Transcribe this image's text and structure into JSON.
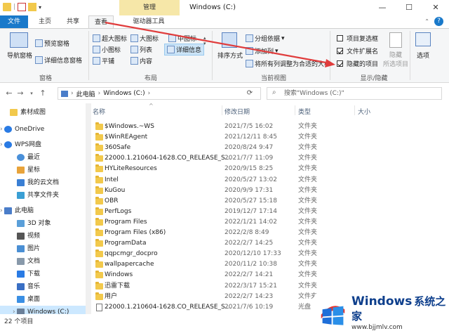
{
  "titlebar": {
    "title": "Windows (C:)",
    "manage_tab": "管理",
    "minimize": "—",
    "maximize": "☐",
    "close": "✕"
  },
  "tabs": [
    "文件",
    "主页",
    "共享",
    "查看",
    "驱动器工具"
  ],
  "ribbon": {
    "nav_pane": "导航窗格",
    "preview_pane": "预览窗格",
    "details_pane": "详细信息窗格",
    "group_pane": "窗格",
    "layouts": [
      "超大图标",
      "大图标",
      "中图标",
      "小图标",
      "列表",
      "详细信息",
      "平铺",
      "内容"
    ],
    "group_layout": "布局",
    "sort_by": "排序方式",
    "group_by": "分组依据",
    "add_column": "添加列",
    "fit_columns": "将所有列调整为合适的大小",
    "group_current_view": "当前视图",
    "item_checkboxes": "项目复选框",
    "file_extensions": "文件扩展名",
    "hidden_items": "隐藏的项目",
    "hide": "隐藏",
    "hide_selected": "所选项目",
    "options": "选项",
    "group_show_hide": "显示/隐藏",
    "checkbox_states": {
      "item_checkboxes": false,
      "file_extensions": true,
      "hidden_items": true
    }
  },
  "address": {
    "path": [
      "此电脑",
      "Windows (C:)"
    ],
    "search_placeholder": "搜索\"Windows (C:)\"",
    "back": "←",
    "forward": "→",
    "up": "↑",
    "refresh": "⟳"
  },
  "nav": [
    {
      "label": "素材成图",
      "icon": "folder-icon"
    },
    {
      "label": "OneDrive",
      "icon": "cloud-icon"
    },
    {
      "label": "WPS网盘",
      "icon": "cloud-icon"
    },
    {
      "label": "最近",
      "icon": "clock-icon"
    },
    {
      "label": "星标",
      "icon": "star-icon"
    },
    {
      "label": "我的云文档",
      "icon": "cloud-doc-icon"
    },
    {
      "label": "共享文件夹",
      "icon": "share-icon"
    },
    {
      "label": "此电脑",
      "icon": "computer-icon"
    },
    {
      "label": "3D 对象",
      "icon": "cube-icon"
    },
    {
      "label": "视频",
      "icon": "video-icon"
    },
    {
      "label": "图片",
      "icon": "picture-icon"
    },
    {
      "label": "文档",
      "icon": "document-icon"
    },
    {
      "label": "下载",
      "icon": "download-icon"
    },
    {
      "label": "音乐",
      "icon": "music-icon"
    },
    {
      "label": "桌面",
      "icon": "desktop-icon"
    },
    {
      "label": "Windows (C:)",
      "icon": "drive-icon"
    }
  ],
  "columns": {
    "name": "名称",
    "date": "修改日期",
    "type": "类型",
    "size": "大小"
  },
  "files": [
    {
      "name": "$Windows.~WS",
      "date": "2021/7/5 16:02",
      "type": "文件夹"
    },
    {
      "name": "$WinREAgent",
      "date": "2021/12/11 8:45",
      "type": "文件夹"
    },
    {
      "name": "360Safe",
      "date": "2020/8/24 9:47",
      "type": "文件夹"
    },
    {
      "name": "22000.1.210604-1628.CO_RELEASE_S...",
      "date": "2021/7/7 11:09",
      "type": "文件夹"
    },
    {
      "name": "HYLiteResources",
      "date": "2020/9/15 8:25",
      "type": "文件夹"
    },
    {
      "name": "Intel",
      "date": "2020/5/27 13:02",
      "type": "文件夹"
    },
    {
      "name": "KuGou",
      "date": "2020/9/9 17:31",
      "type": "文件夹"
    },
    {
      "name": "OBR",
      "date": "2020/5/27 15:18",
      "type": "文件夹"
    },
    {
      "name": "PerfLogs",
      "date": "2019/12/7 17:14",
      "type": "文件夹"
    },
    {
      "name": "Program Files",
      "date": "2022/1/21 14:02",
      "type": "文件夹"
    },
    {
      "name": "Program Files (x86)",
      "date": "2022/2/8 8:49",
      "type": "文件夹"
    },
    {
      "name": "ProgramData",
      "date": "2022/2/7 14:25",
      "type": "文件夹"
    },
    {
      "name": "qqpcmgr_docpro",
      "date": "2020/12/10 17:33",
      "type": "文件夹"
    },
    {
      "name": "wallpapercache",
      "date": "2020/11/2 10:38",
      "type": "文件夹"
    },
    {
      "name": "Windows",
      "date": "2022/2/7 14:21",
      "type": "文件夹"
    },
    {
      "name": "迅雷下载",
      "date": "2022/3/17 15:21",
      "type": "文件夹"
    },
    {
      "name": "用户",
      "date": "2022/2/7 14:23",
      "type": "文件夹"
    },
    {
      "name": "22000.1.210604-1628.CO_RELEASE_S...",
      "date": "2021/7/6 10:19",
      "type": "光盘"
    }
  ],
  "status": {
    "count": "22 个项目"
  },
  "watermark": {
    "brand": "Windows",
    "sub": "系统之家",
    "url": "www.bjjmlv.com"
  },
  "colors": {
    "file_tab": "#1979ca",
    "manage_tab": "#f6e7a8",
    "arrow": "#e03c3c",
    "folder": "#f2c94c"
  }
}
